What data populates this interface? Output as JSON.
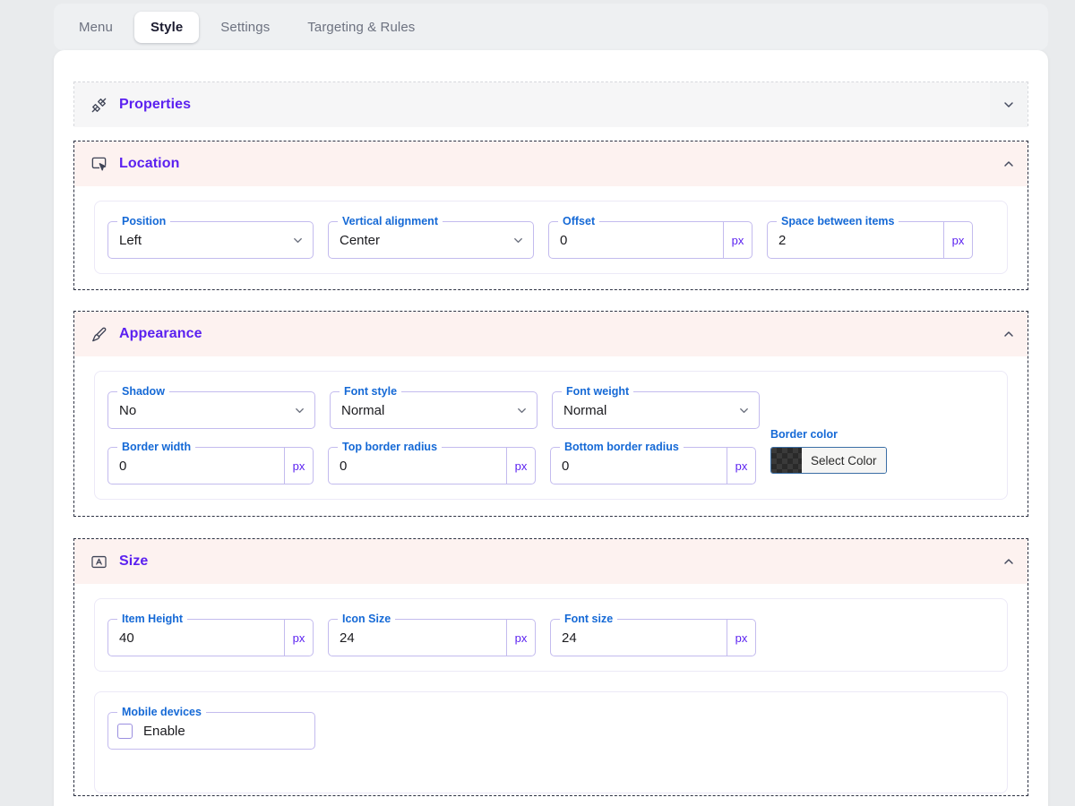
{
  "tabs": [
    {
      "label": "Menu",
      "active": false
    },
    {
      "label": "Style",
      "active": true
    },
    {
      "label": "Settings",
      "active": false
    },
    {
      "label": "Targeting & Rules",
      "active": false
    }
  ],
  "colors": {
    "accent_title": "#5b21f0",
    "field_label": "#1569d6",
    "field_border": "#c3bbee",
    "suffix": "#5b21f0",
    "section_tint": "#fdf2f0",
    "page_bg": "#e9ebed"
  },
  "sections": {
    "properties": {
      "title": "Properties",
      "icon": "tools-icon",
      "chevron": "chevron-down-icon",
      "expanded": false
    },
    "location": {
      "title": "Location",
      "icon": "cursor-frame-icon",
      "chevron": "chevron-up-icon",
      "expanded": true,
      "fields": [
        {
          "label": "Position",
          "value": "Left",
          "type": "select"
        },
        {
          "label": "Vertical alignment",
          "value": "Center",
          "type": "select"
        },
        {
          "label": "Offset",
          "value": "0",
          "type": "number",
          "suffix": "px"
        },
        {
          "label": "Space between items",
          "value": "2",
          "type": "number",
          "suffix": "px"
        }
      ]
    },
    "appearance": {
      "title": "Appearance",
      "icon": "paintbrush-icon",
      "chevron": "chevron-up-icon",
      "expanded": true,
      "row1": [
        {
          "label": "Shadow",
          "value": "No",
          "type": "select"
        },
        {
          "label": "Font style",
          "value": "Normal",
          "type": "select"
        },
        {
          "label": "Font weight",
          "value": "Normal",
          "type": "select"
        }
      ],
      "row2": [
        {
          "label": "Border width",
          "value": "0",
          "type": "number",
          "suffix": "px"
        },
        {
          "label": "Top border radius",
          "value": "0",
          "type": "number",
          "suffix": "px"
        },
        {
          "label": "Bottom border radius",
          "value": "0",
          "type": "number",
          "suffix": "px"
        }
      ],
      "border_color": {
        "label": "Border color",
        "button_text": "Select Color",
        "swatch": "transparent-checker"
      }
    },
    "size": {
      "title": "Size",
      "icon": "font-size-icon",
      "chevron": "chevron-up-icon",
      "expanded": true,
      "fields": [
        {
          "label": "Item Height",
          "value": "40",
          "type": "number",
          "suffix": "px"
        },
        {
          "label": "Icon Size",
          "value": "24",
          "type": "number",
          "suffix": "px"
        },
        {
          "label": "Font size",
          "value": "24",
          "type": "number",
          "suffix": "px"
        }
      ],
      "mobile": {
        "label": "Mobile devices",
        "checkbox_label": "Enable",
        "checked": false
      }
    }
  }
}
